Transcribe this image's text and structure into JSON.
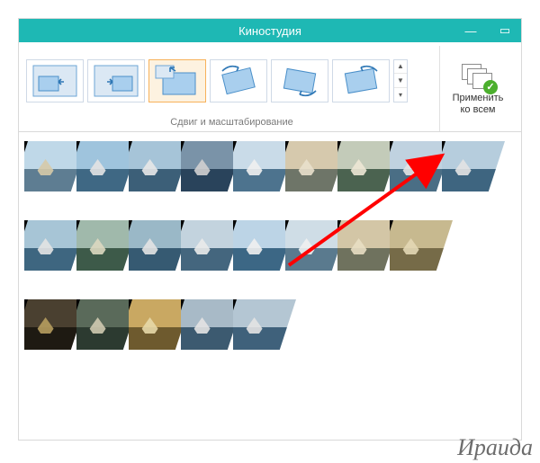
{
  "window": {
    "title": "Киностудия",
    "min": "—",
    "max": "▭"
  },
  "ribbon": {
    "group_label": "Сдвиг и масштабирование",
    "apply_label_l1": "Применить",
    "apply_label_l2": "ко всем",
    "scroll_up": "▲",
    "scroll_down": "▼",
    "scroll_more": "▾"
  },
  "timeline": {
    "strips": [
      {
        "clips": [
          {
            "sky": "#bfd8e8",
            "sea": "#5e7d92",
            "ship": "#d6caa8"
          },
          {
            "sky": "#9fc4dd",
            "sea": "#3f6884",
            "ship": "#e3e3e3"
          },
          {
            "sky": "#a6c4d8",
            "sea": "#3c5f78",
            "ship": "#e8e8e8"
          },
          {
            "sky": "#7a93a8",
            "sea": "#29435b",
            "ship": "#d0d0d0"
          },
          {
            "sky": "#c9dbe8",
            "sea": "#4d738e",
            "ship": "#efefef"
          },
          {
            "sky": "#d6c9ad",
            "sea": "#6e7568",
            "ship": "#e9e0cc"
          },
          {
            "sky": "#c3cbb9",
            "sea": "#4b6350",
            "ship": "#ede7d5"
          },
          {
            "sky": "#c0d2e0",
            "sea": "#4a6e85",
            "ship": "#e3e3e3"
          },
          {
            "sky": "#b6cddd",
            "sea": "#3e6580",
            "ship": "#e3e3e3"
          }
        ]
      },
      {
        "clips": [
          {
            "sky": "#a7c5d6",
            "sea": "#3e6680",
            "ship": "#e3e3e3"
          },
          {
            "sky": "#a0b9ab",
            "sea": "#3d5a49",
            "ship": "#dcd8c0"
          },
          {
            "sky": "#9ab8c7",
            "sea": "#365a72",
            "ship": "#e3e3e3"
          },
          {
            "sky": "#c3d3de",
            "sea": "#44667e",
            "ship": "#eaeaea"
          },
          {
            "sky": "#bcd4e6",
            "sea": "#3c6785",
            "ship": "#efefef"
          },
          {
            "sky": "#cfdde6",
            "sea": "#5a7a8e",
            "ship": "#efefef"
          },
          {
            "sky": "#d3c6a6",
            "sea": "#6f725e",
            "ship": "#e8dec3"
          },
          {
            "sky": "#c7b98f",
            "sea": "#766b48",
            "ship": "#e3d8b5"
          }
        ]
      },
      {
        "clips": [
          {
            "sky": "#4a4030",
            "sea": "#1e1a12",
            "ship": "#b69d5f"
          },
          {
            "sky": "#5a6a5a",
            "sea": "#2c3a30",
            "ship": "#cfcab0"
          },
          {
            "sky": "#c9a862",
            "sea": "#6e5a2e",
            "ship": "#e7d8a8"
          },
          {
            "sky": "#a8bac7",
            "sea": "#3c5a70",
            "ship": "#e3e3e3"
          },
          {
            "sky": "#b4c6d3",
            "sea": "#3f617b",
            "ship": "#e3e3e3"
          }
        ]
      }
    ]
  },
  "signature": "Ираида"
}
